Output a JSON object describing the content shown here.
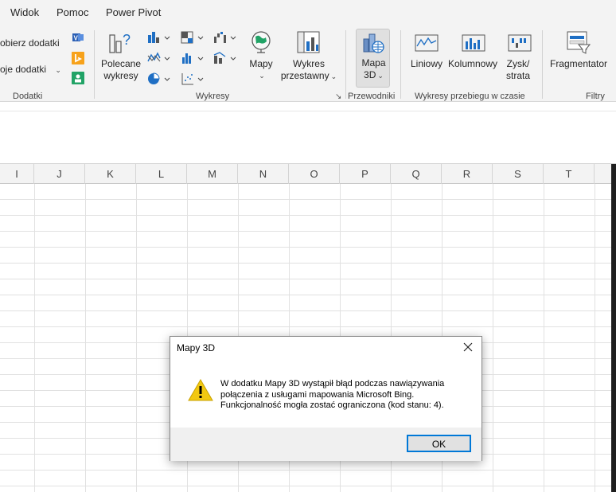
{
  "menu": {
    "tabs": [
      "Widok",
      "Pomoc",
      "Power Pivot"
    ]
  },
  "ribbon": {
    "addins": {
      "get_label": "obierz dodatki",
      "my_label": "oje dodatki",
      "group_label": "Dodatki"
    },
    "charts": {
      "recommended_line1": "Polecane",
      "recommended_line2": "wykresy",
      "maps_label": "Mapy",
      "pivot_line1": "Wykres",
      "pivot_line2": "przestawny",
      "group_label": "Wykresy"
    },
    "tours": {
      "map3d_line1": "Mapa",
      "map3d_line2": "3D",
      "group_label": "Przewodniki"
    },
    "sparklines": {
      "line_label": "Liniowy",
      "column_label": "Kolumnowy",
      "winloss_line1": "Zysk/",
      "winloss_line2": "strata",
      "group_label": "Wykresy przebiegu w czasie"
    },
    "filters": {
      "slicer_label": "Fragmentator",
      "group_label": "Filtry"
    }
  },
  "columns": [
    "I",
    "J",
    "K",
    "L",
    "M",
    "N",
    "O",
    "P",
    "Q",
    "R",
    "S",
    "T"
  ],
  "dialog": {
    "title": "Mapy 3D",
    "message_line1": "W dodatku Mapy 3D wystąpił błąd podczas nawiązywania",
    "message_line2": "połączenia z usługami mapowania Microsoft Bing.",
    "message_line3": "Funkcjonalność mogła zostać ograniczona (kod stanu: 4).",
    "ok_label": "OK"
  },
  "colors": {
    "accent": "#0078d7",
    "warning": "#f2c811"
  }
}
